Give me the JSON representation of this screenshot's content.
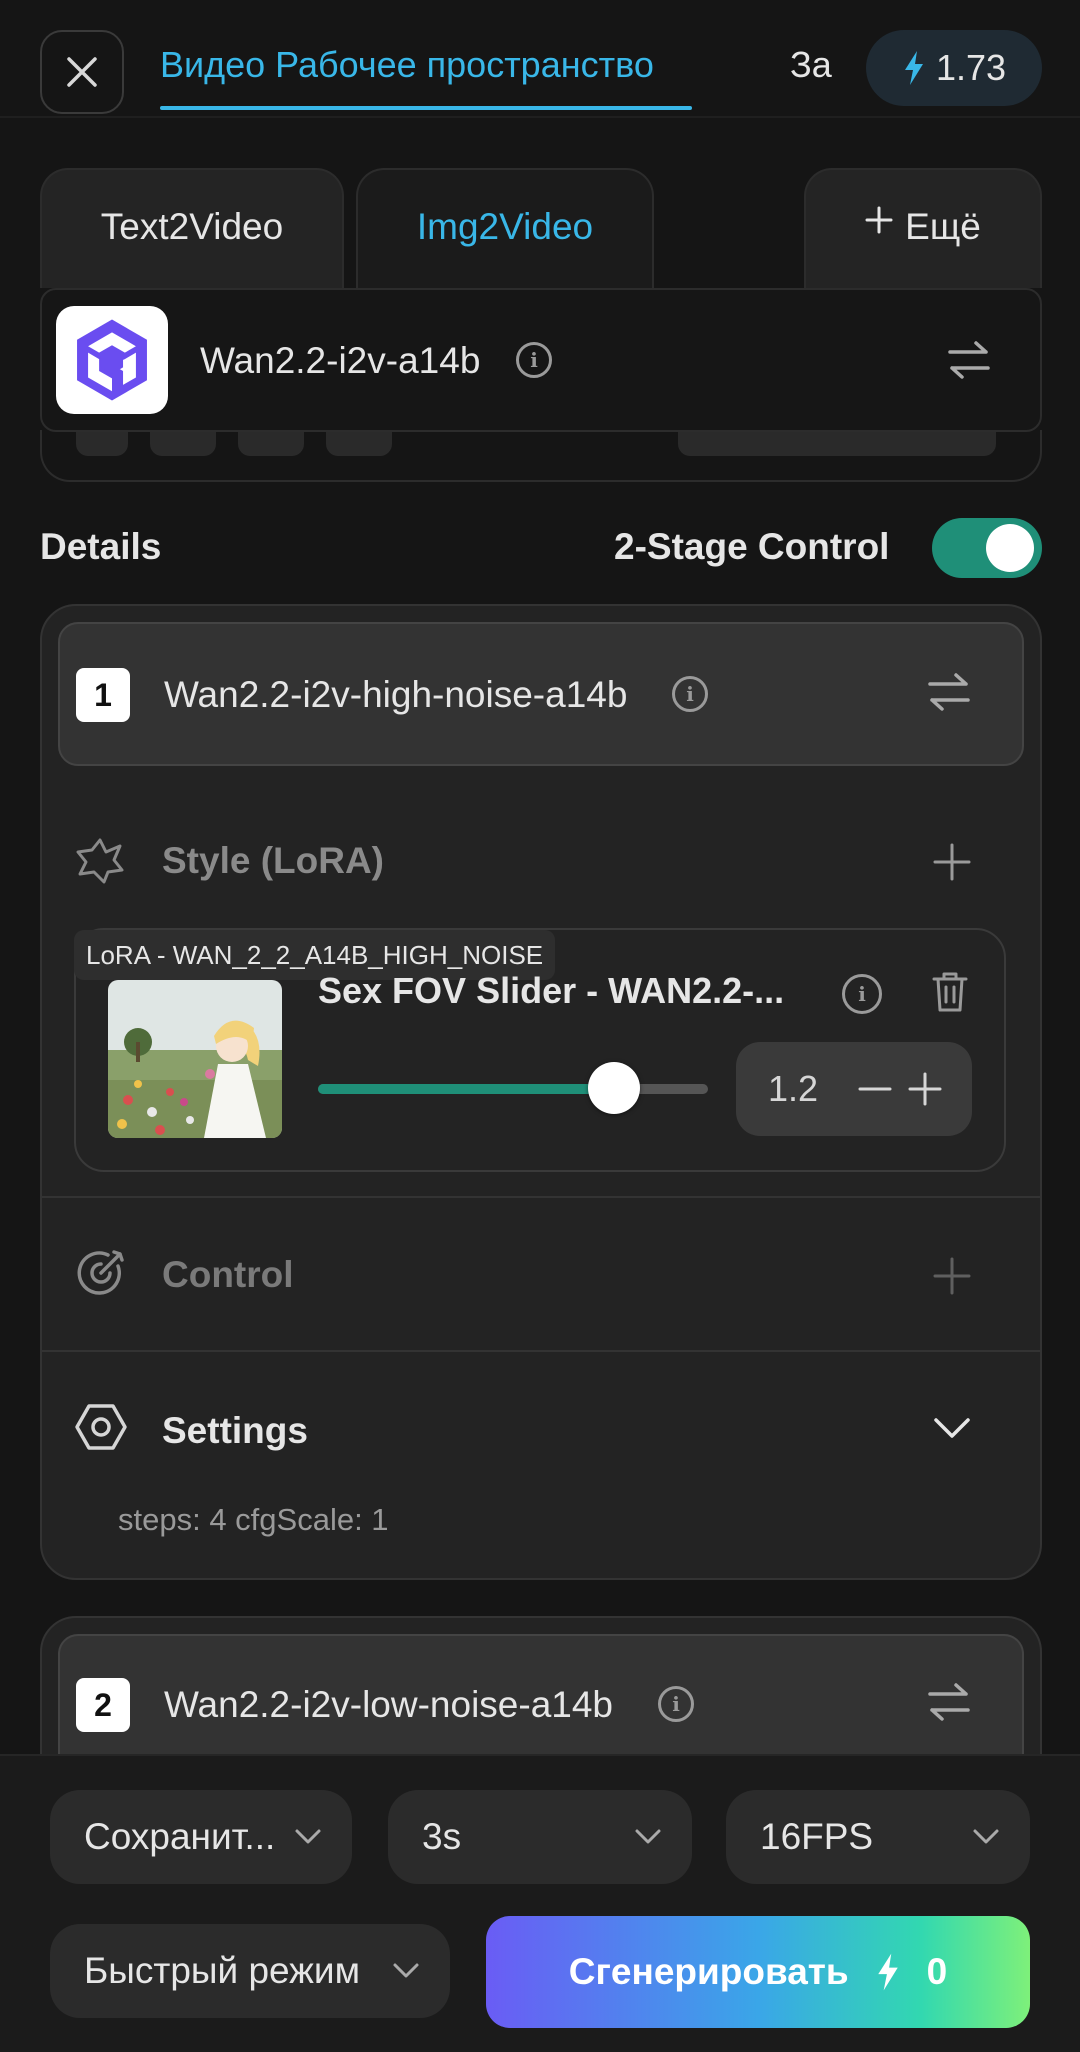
{
  "header": {
    "workspace_title": "Видео Рабочее пространство",
    "za_label": "За",
    "credits": "1.73"
  },
  "tabs": [
    {
      "label": "Text2Video",
      "active": false
    },
    {
      "label": "Img2Video",
      "active": true
    },
    {
      "label": "Ещё",
      "active": false
    }
  ],
  "model": {
    "name": "Wan2.2-i2v-a14b"
  },
  "details": {
    "label": "Details",
    "two_stage_label": "2-Stage Control",
    "two_stage_enabled": true
  },
  "stage1": {
    "number": "1",
    "model_name": "Wan2.2-i2v-high-noise-a14b",
    "style_label": "Style (LoRA)",
    "lora": {
      "tag": "LoRA - WAN_2_2_A14B_HIGH_NOISE",
      "name": "Sex FOV Slider - WAN2.2-...",
      "strength": "1.2",
      "slider_fraction": 0.76
    },
    "control_label": "Control",
    "settings_label": "Settings",
    "settings_summary": "steps: 4 cfgScale: 1"
  },
  "stage2": {
    "number": "2",
    "model_name": "Wan2.2-i2v-low-noise-a14b"
  },
  "bottom": {
    "save_dropdown": "Сохранит...",
    "duration_dropdown": "3s",
    "fps_dropdown": "16FPS",
    "mode_dropdown": "Быстрый режим",
    "generate_label": "Сгенерировать",
    "generate_cost": "0"
  },
  "colors": {
    "accent": "#39b7e8",
    "toggle_on": "#1f8f78",
    "background": "#151515"
  }
}
